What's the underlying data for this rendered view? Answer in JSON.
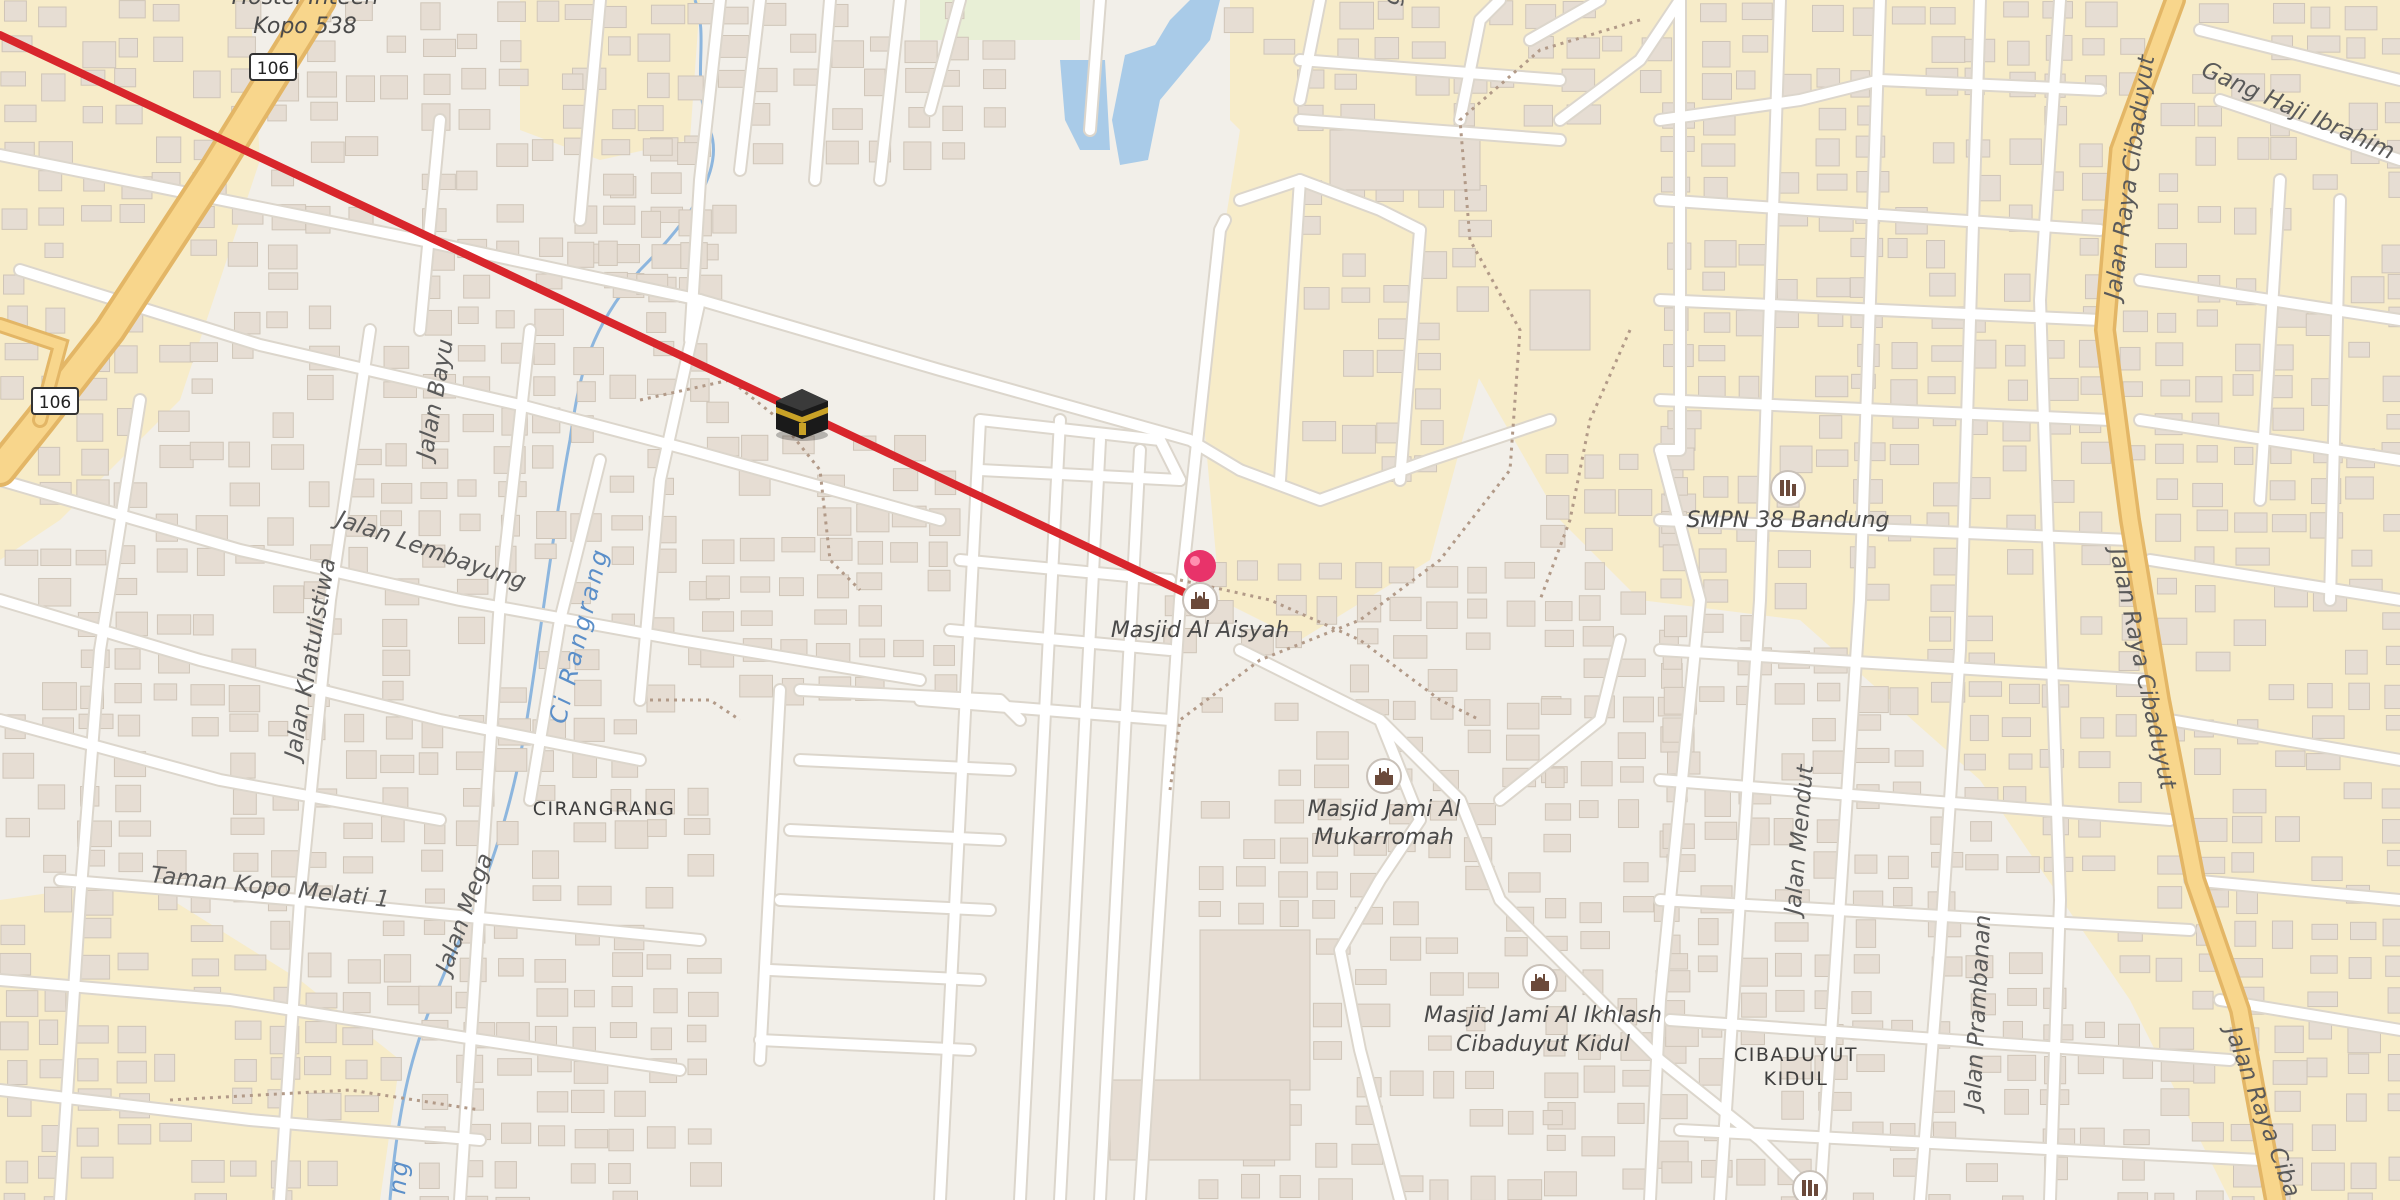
{
  "map": {
    "colors": {
      "land": "#f2efe9",
      "residential": "#f7ecc9",
      "road": "#ffffff",
      "road_casing": "#dcd6cc",
      "major_road": "#f8d68c",
      "major_road_casing": "#e3b666",
      "building": "#e6ddd3",
      "building_edge": "#cfc5b8",
      "water": "#a9cbe8",
      "route_line": "#d8262c",
      "pin": "#e8336a"
    },
    "route_shields": [
      {
        "text": "106"
      },
      {
        "text": "106"
      }
    ],
    "places": {
      "hostel_line1": "Hostel Inteen",
      "hostel_line2": "Kopo 538",
      "masjid_al_aisyah": "Masjid Al Aisyah",
      "smpn": "SMPN 38 Bandung",
      "masjid_mukarromah_1": "Masjid Jami Al",
      "masjid_mukarromah_2": "Mukarromah",
      "masjid_ikhlash_1": "Masjid Jami Al Ikhlash",
      "masjid_ikhlash_2": "Cibaduyut Kidul"
    },
    "areas": {
      "cirangrang": "CIRANGRANG",
      "cibaduyut_1": "CIBADUYUT",
      "cibaduyut_2": "KIDUL"
    },
    "roads": {
      "gang_haji_ibrahim": "Gang Haji Ibrahim",
      "jalan_raya_cibaduyut": "Jalan Raya Cibaduyut",
      "jalan_raya_cibaduyut_cut": "Jalan Raya Ciba",
      "jalan_bayu": "Jalan Bayu",
      "jalan_lembayung": "Jalan Lembayung",
      "jalan_khatulistiwa": "Jalan Khatulistiwa",
      "taman_kopo_melati": "Taman Kopo Melati 1",
      "jalan_mega": "Jalan Mega",
      "jalan_mendut": "Jalan Mendut",
      "jalan_prambanan": "Jalan Prambanan",
      "gang_fragment": "g"
    },
    "river": {
      "ci_rangrang": "Ci Rangrang",
      "fragment": "ng"
    },
    "icons": {
      "kaaba": "kaaba-icon",
      "pin": "location-pin-icon",
      "mosque": "mosque-icon",
      "school": "school-icon"
    }
  }
}
